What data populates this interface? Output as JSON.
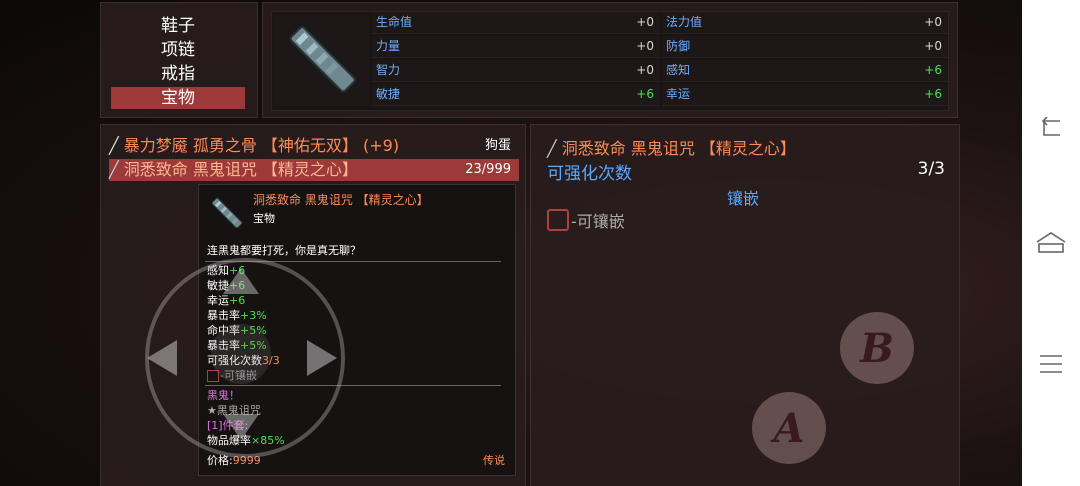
{
  "categories": {
    "items": [
      "鞋子",
      "项链",
      "戒指",
      "宝物"
    ],
    "selected_index": 3
  },
  "stats": {
    "left": [
      {
        "name": "生命值",
        "value": "+0"
      },
      {
        "name": "力量",
        "value": "+0"
      },
      {
        "name": "智力",
        "value": "+0"
      },
      {
        "name": "敏捷",
        "value": "+6"
      }
    ],
    "right": [
      {
        "name": "法力值",
        "value": "+0"
      },
      {
        "name": "防御",
        "value": "+0"
      },
      {
        "name": "感知",
        "value": "+6"
      },
      {
        "name": "幸运",
        "value": "+6"
      }
    ]
  },
  "item_list": [
    {
      "name": "暴力梦魇 孤勇之骨 【神佑无双】 (+9)",
      "owner": "狗蛋"
    },
    {
      "name": "洞悉致命 黑鬼诅咒 【精灵之心】",
      "owner": "23/999"
    }
  ],
  "tooltip": {
    "title": "洞悉致命 黑鬼诅咒 【精灵之心】",
    "type": "宝物",
    "description": "连黑鬼都要打死，你是真无聊？",
    "attrs": [
      {
        "name": "感知",
        "value": "+6"
      },
      {
        "name": "敏捷",
        "value": "+6"
      },
      {
        "name": "幸运",
        "value": "+6"
      },
      {
        "name": "暴击率",
        "value": "+3%"
      },
      {
        "name": "命中率",
        "value": "+5%"
      },
      {
        "name": "暴击率",
        "value": "+5%"
      }
    ],
    "enhance_label": "可强化次数",
    "enhance_value": "3/3",
    "socket_label": "-可镶嵌",
    "set_line1": "黑鬼！",
    "set_line2": "★黑鬼诅咒",
    "set_line3": "[1]件套:",
    "set_bonus_label": "物品爆率",
    "set_bonus_value": "×85%",
    "price_label": "价格:",
    "price_value": "9999",
    "rarity": "传说"
  },
  "detail": {
    "title": "洞悉致命 黑鬼诅咒 【精灵之心】",
    "enhance_label": "可强化次数",
    "enhance_value": "3/3",
    "inlay_button": "镶嵌",
    "socket_label": "-可镶嵌"
  },
  "controls": {
    "button_b": "B",
    "button_a": "A"
  },
  "colors": {
    "stat_name": "#6ab0ff",
    "positive": "#4ee04e",
    "item_name": "#ff8a55",
    "selection": "#9c3a3a",
    "price": "#ff8a55",
    "set_name": "#e070e0"
  },
  "icons": [
    "item-icon",
    "sword-icon",
    "scroll-icon",
    "dpad-left-icon",
    "dpad-right-icon",
    "dpad-up-icon",
    "dpad-down-icon",
    "back-icon",
    "home-icon",
    "menu-icon"
  ]
}
